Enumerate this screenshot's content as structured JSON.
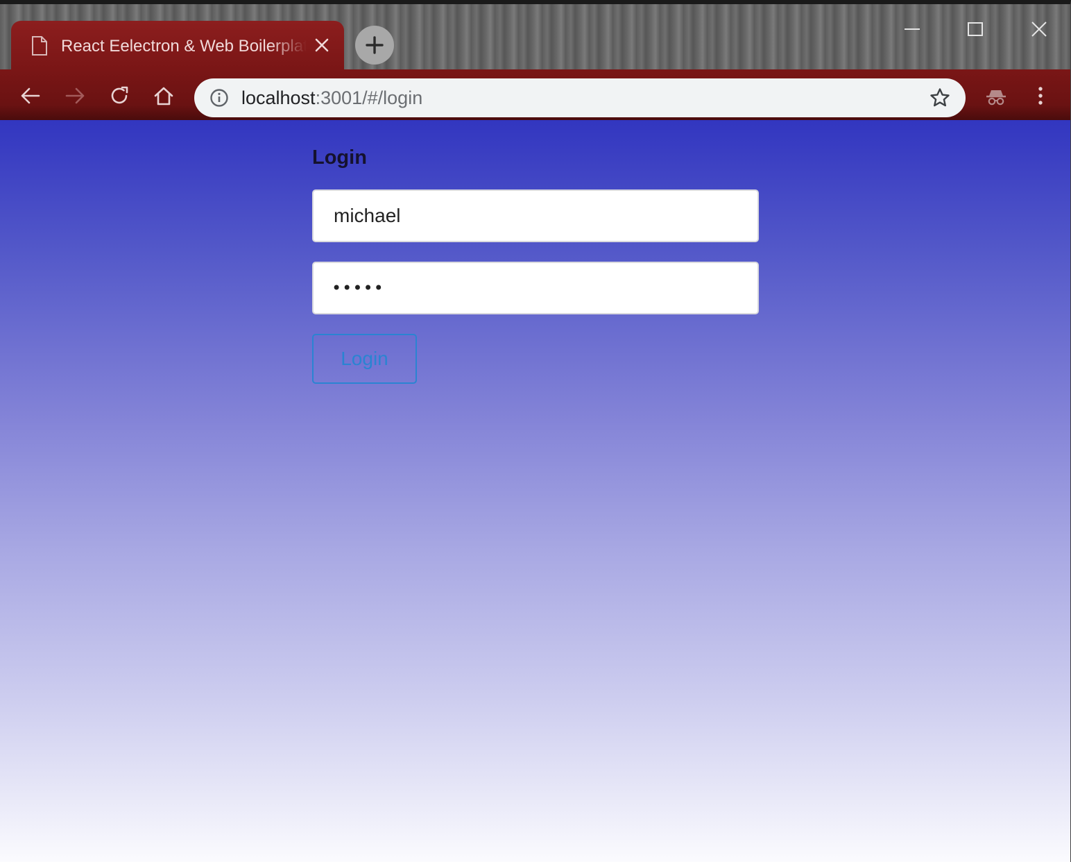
{
  "browser": {
    "tab": {
      "title": "React Eelectron & Web Boilerplate",
      "icon": "file-icon"
    },
    "new_tab_icon": "plus-icon",
    "window_controls": [
      "minimize-icon",
      "maximize-icon",
      "close-icon"
    ],
    "toolbar": {
      "icons": [
        "back-arrow-icon",
        "forward-arrow-icon",
        "reload-icon",
        "home-icon"
      ]
    },
    "address_bar": {
      "host": "localhost",
      "path": ":3001/#/login",
      "info_icon": "info-icon",
      "bookmark_icon": "star-icon"
    },
    "right_icons": [
      "incognito-icon",
      "kebab-menu-icon"
    ],
    "colors": {
      "tab": "#8c1e1e",
      "toolbar": "#7a1616",
      "omnibox": "#f1f3f4"
    }
  },
  "page": {
    "heading": "Login",
    "username": {
      "value": "michael"
    },
    "password": {
      "masked_value": "•••••"
    },
    "login_button": "Login",
    "colors": {
      "gradient_top": "#3236c0",
      "gradient_bottom": "#fbfbfe",
      "button_accent": "#2a84d2"
    }
  }
}
